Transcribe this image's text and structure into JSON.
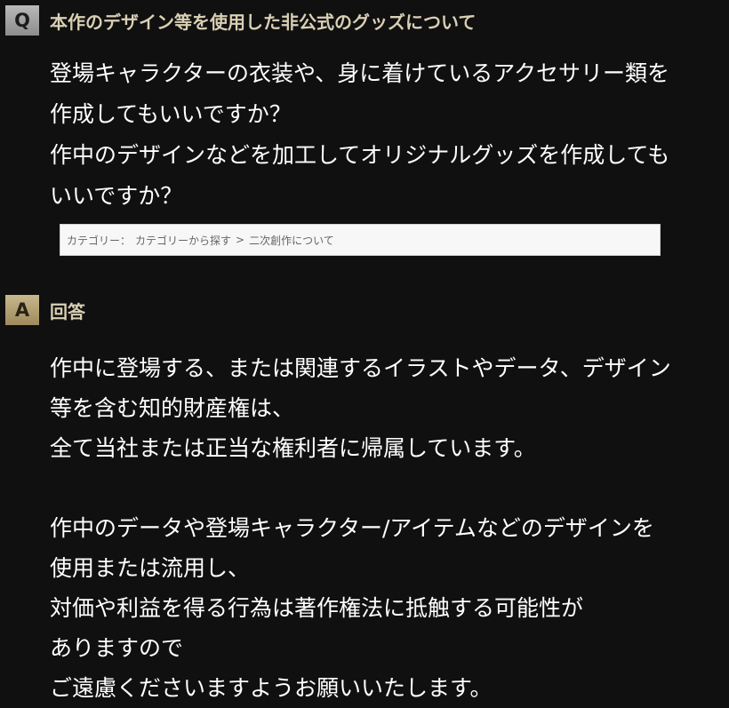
{
  "question": {
    "badge": "Q",
    "title": "本作のデザイン等を使用した非公式のグッズについて",
    "lines": [
      "登場キャラクターの衣装や、身に着けているアクセサリー類を",
      "作成してもいいですか？",
      "作中のデザインなどを加工してオリジナルグッズを作成しても",
      "いいですか？"
    ]
  },
  "category": {
    "label": "カテゴリー：",
    "link": "カテゴリーから探す",
    "separator": ">",
    "current": "二次創作について"
  },
  "answer": {
    "badge": "A",
    "title": "回答",
    "lines": [
      "作中に登場する、または関連するイラストやデータ、デザイン",
      "等を含む知的財産権は、",
      "全て当社または正当な権利者に帰属しています。",
      "",
      "作中のデータや登場キャラクター/アイテムなどのデザインを",
      "使用または流用し、",
      "対価や利益を得る行為は著作権法に抵触する可能性が",
      "ありますので",
      "ご遠慮くださいますようお願いいたします。"
    ]
  },
  "colors": {
    "background": "#101010",
    "title_text": "#d9cfb4",
    "body_text": "#ffffff",
    "badge_q": "#a3a3a3",
    "badge_a": "#b5a273"
  }
}
